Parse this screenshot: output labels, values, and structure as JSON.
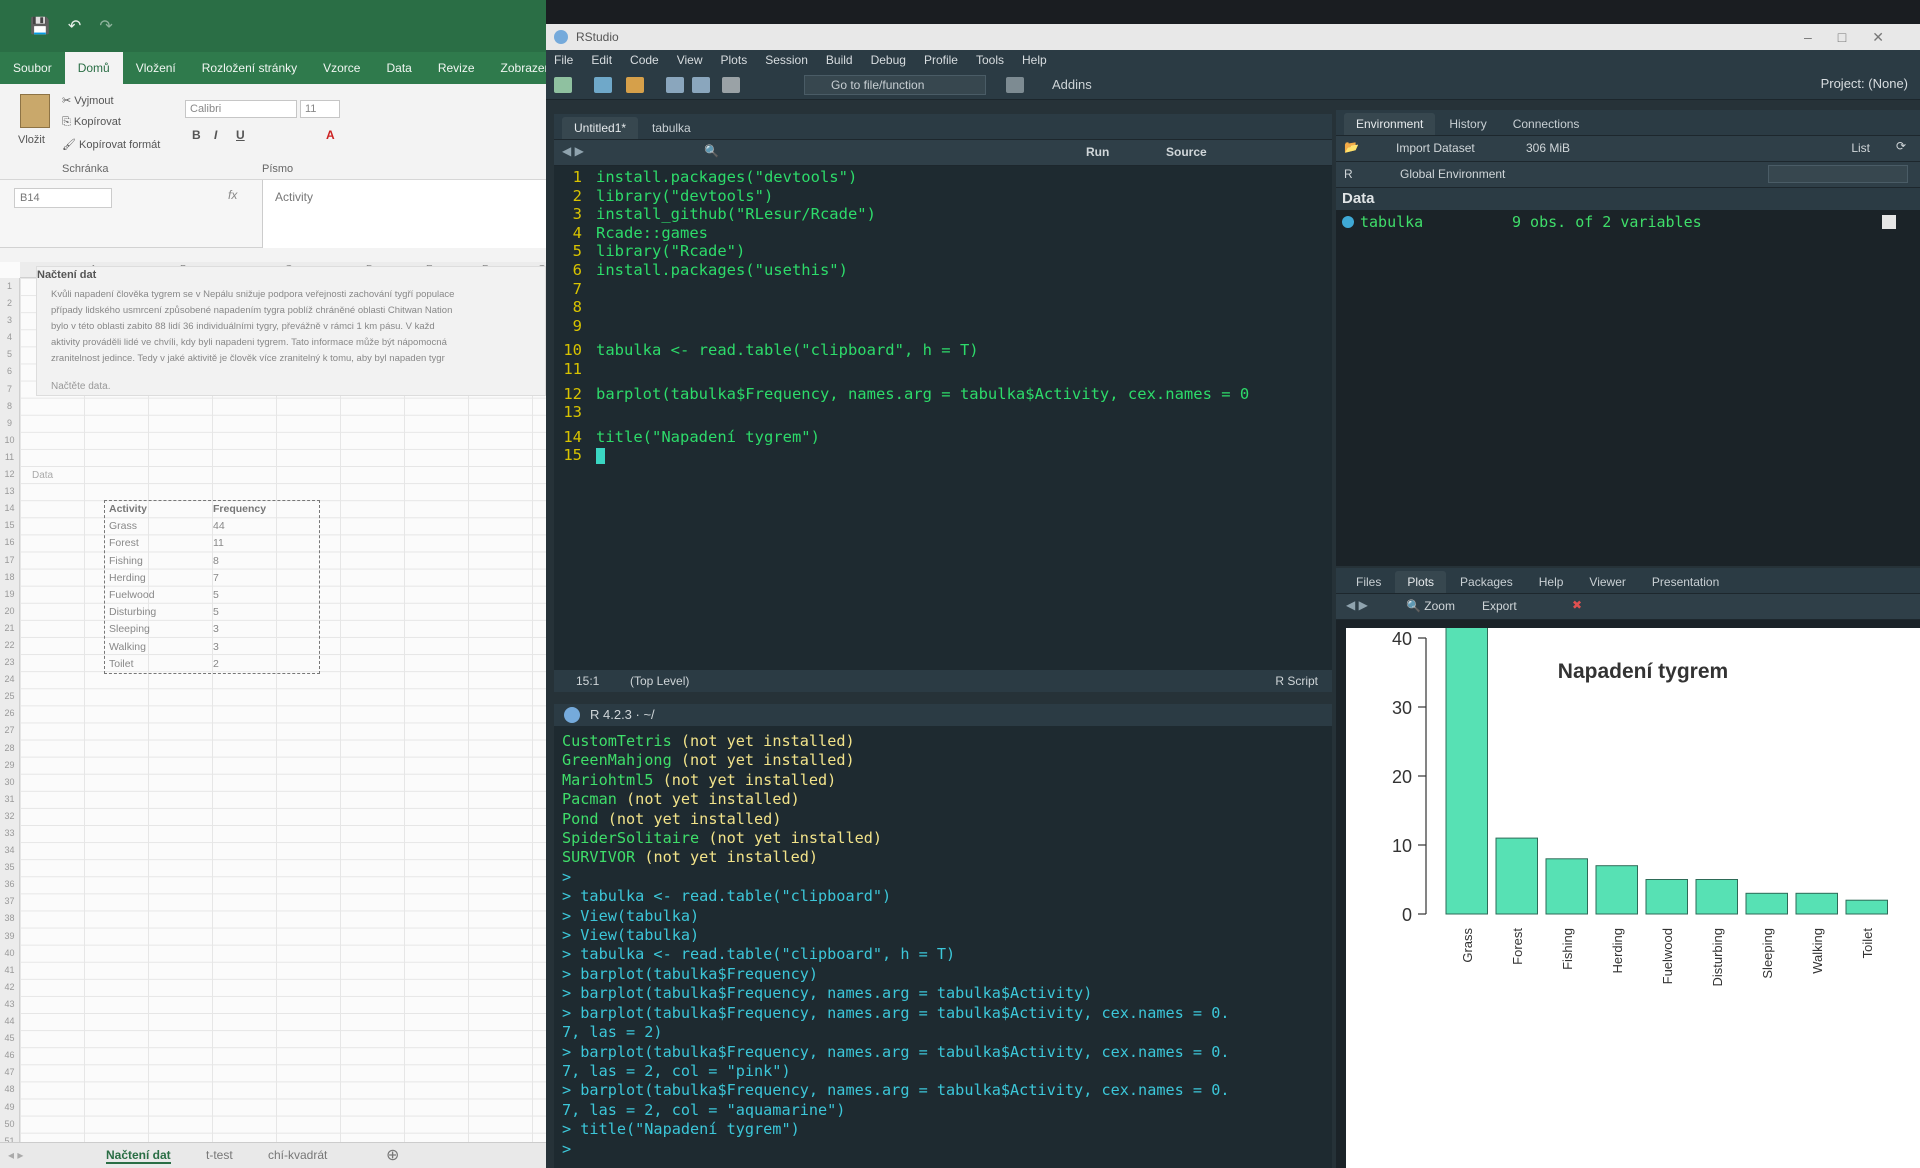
{
  "excel": {
    "ribbon_tabs": [
      "Soubor",
      "Domů",
      "Vložení",
      "Rozložení stránky",
      "Vzorce",
      "Data",
      "Revize",
      "Zobrazení"
    ],
    "active_tab": "Domů",
    "clipboard": {
      "paste": "Vložit",
      "cut": "Vyjmout",
      "copy": "Kopírovat",
      "format_painter": "Kopírovat formát",
      "group": "Schránka"
    },
    "font": {
      "name": "Calibri",
      "size": "11",
      "group": "Písmo",
      "bold": "B",
      "italic": "I",
      "underline": "U"
    },
    "namebox": "B14",
    "formula_value": "Activity",
    "columns": [
      "A",
      "B",
      "C",
      "D",
      "E",
      "F",
      "G"
    ],
    "heading": "Načtení dat",
    "paragraph": [
      "Kvůli napadení člověka tygrem se v Nepálu snižuje podpora veřejnosti zachování tygří populace",
      "případy lidského usmrcení způsobené napadením tygra poblíž chráněné oblasti Chitwan Nation",
      "bylo v této oblasti zabito 88 lidí 36 individuálními tygry, převážně v rámci 1 km pásu. V každ",
      "aktivity prováděli lidé ve chvíli, kdy byli napadeni tygrem. Tato informace může být nápomocná",
      "zranitelnost jedince. Tedy v jaké aktivitě je člověk více zranitelný k tomu, aby byl napaden tygr"
    ],
    "hint": "Načtěte data.",
    "data_label": "Data",
    "table": {
      "headers": [
        "Activity",
        "Frequency"
      ],
      "rows": [
        [
          "Grass",
          "44"
        ],
        [
          "Forest",
          "11"
        ],
        [
          "Fishing",
          "8"
        ],
        [
          "Herding",
          "7"
        ],
        [
          "Fuelwood",
          "5"
        ],
        [
          "Disturbing",
          "5"
        ],
        [
          "Sleeping",
          "3"
        ],
        [
          "Walking",
          "3"
        ],
        [
          "Toilet",
          "2"
        ]
      ]
    },
    "sheet_tabs": [
      "Načtení dat",
      "t-test",
      "chí-kvadrát"
    ]
  },
  "rstudio": {
    "window_title": "RStudio",
    "menu": [
      "File",
      "Edit",
      "Code",
      "View",
      "Plots",
      "Session",
      "Build",
      "Debug",
      "Profile",
      "Tools",
      "Help"
    ],
    "goto_file": "Go to file/function",
    "addins": "Addins",
    "project": "Project: (None)",
    "editor": {
      "tabs": [
        "Untitled1*",
        "tabulka"
      ],
      "run": "Run",
      "source": "Source",
      "lines": [
        "install.packages(\"devtools\")",
        "library(\"devtools\")",
        "install_github(\"RLesur/Rcade\")",
        "Rcade::games",
        "library(\"Rcade\")",
        "install.packages(\"usethis\")",
        "",
        "",
        "",
        "tabulka <- read.table(\"clipboard\", h = T)",
        "",
        "barplot(tabulka$Frequency, names.arg = tabulka$Activity, cex.names = 0",
        "",
        "title(\"Napadení tygrem\")",
        ""
      ],
      "position": "15:1",
      "scope": "(Top Level)",
      "filetype": "R Script"
    },
    "console": {
      "header": "R 4.2.3 · ~/",
      "games": [
        [
          "CustomTetris",
          "(not yet installed)"
        ],
        [
          "GreenMahjong",
          "(not yet installed)"
        ],
        [
          "Mariohtml5",
          "(not yet installed)"
        ],
        [
          "Pacman",
          "(not yet installed)"
        ],
        [
          "Pond",
          "(not yet installed)"
        ],
        [
          "SpiderSolitaire",
          "(not yet installed)"
        ],
        [
          "SURVIVOR",
          "(not yet installed)"
        ]
      ],
      "history": [
        ">",
        "> tabulka <- read.table(\"clipboard\")",
        "> View(tabulka)",
        "> View(tabulka)",
        "> tabulka <- read.table(\"clipboard\", h = T)",
        "> barplot(tabulka$Frequency)",
        "> barplot(tabulka$Frequency, names.arg = tabulka$Activity)",
        "> barplot(tabulka$Frequency, names.arg = tabulka$Activity, cex.names = 0.",
        "7, las = 2)",
        "> barplot(tabulka$Frequency, names.arg = tabulka$Activity, cex.names = 0.",
        "7, las = 2, col = \"pink\")",
        "> barplot(tabulka$Frequency, names.arg = tabulka$Activity, cex.names = 0.",
        "7, las = 2, col = \"aquamarine\")",
        "> title(\"Napadení tygrem\")",
        ">"
      ]
    },
    "environment": {
      "tabs": [
        "Environment",
        "History",
        "Connections"
      ],
      "import_dataset": "Import Dataset",
      "memory": "306 MiB",
      "view_mode": "List",
      "lang": "R",
      "scope": "Global Environment",
      "section": "Data",
      "var_name": "tabulka",
      "var_desc": "9 obs. of 2 variables"
    },
    "plots": {
      "tabs": [
        "Files",
        "Plots",
        "Packages",
        "Help",
        "Viewer",
        "Presentation"
      ],
      "zoom": "Zoom",
      "export": "Export"
    }
  },
  "chart_data": {
    "type": "bar",
    "title": "Napadení tygrem",
    "categories": [
      "Grass",
      "Forest",
      "Fishing",
      "Herding",
      "Fuelwood",
      "Disturbing",
      "Sleeping",
      "Walking",
      "Toilet"
    ],
    "values": [
      44,
      11,
      8,
      7,
      5,
      5,
      3,
      3,
      2
    ],
    "yticks": [
      0,
      10,
      20,
      30,
      40
    ],
    "ylim": [
      0,
      44
    ],
    "color": "#57e1b4"
  }
}
